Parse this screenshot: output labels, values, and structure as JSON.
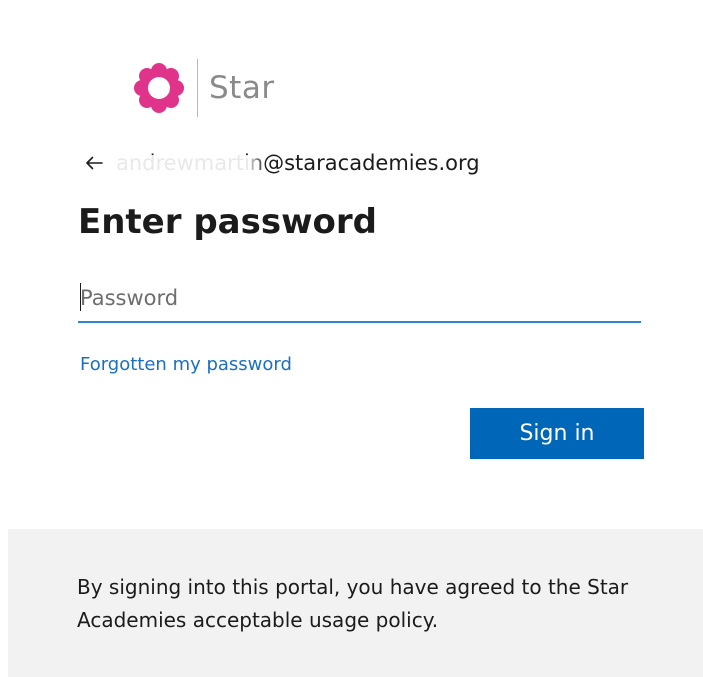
{
  "brand": {
    "logo_icon": "star-academies-flower-icon",
    "name": "Star",
    "logo_color": "#e0338a"
  },
  "identity": {
    "back_icon": "arrow-left-icon",
    "email": "andrewmartin@staracademies.org"
  },
  "form": {
    "title": "Enter password",
    "password_placeholder": "Password",
    "password_value": "",
    "forgot_link": "Forgotten my password",
    "sign_in_label": "Sign in"
  },
  "notice": {
    "text": "By signing into this portal, you have agreed to the Star Academies acceptable usage policy."
  },
  "colors": {
    "accent": "#0067b8",
    "link": "#1a6fc2",
    "input_underline": "#2f86d0",
    "notice_bg": "#f2f2f2"
  }
}
